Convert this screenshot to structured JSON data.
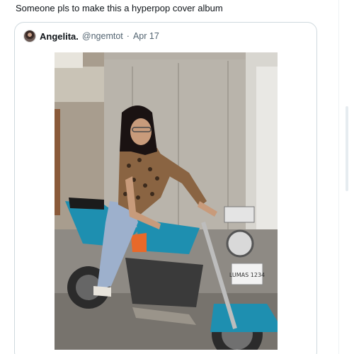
{
  "tweet": {
    "text": "Someone pls to make this a hyperpop cover album"
  },
  "quoted_tweet": {
    "display_name": "Angelita.",
    "handle": "@ngemtot",
    "separator": "·",
    "date": "Apr 17",
    "media": {
      "plate_text": "LUMAS 1234"
    }
  },
  "colors": {
    "border": "#cfd9de",
    "secondary_text": "#536471",
    "primary_text": "#0f1419",
    "bike_teal": "#1e8fb0"
  }
}
